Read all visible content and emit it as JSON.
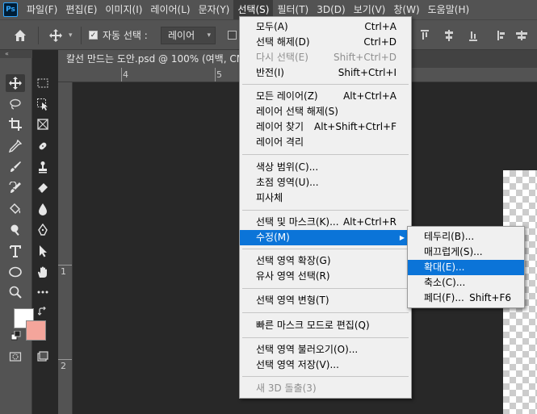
{
  "app": {
    "logo_text": "Ps"
  },
  "menubar": {
    "items": [
      {
        "label": "파일(F)"
      },
      {
        "label": "편집(E)"
      },
      {
        "label": "이미지(I)"
      },
      {
        "label": "레이어(L)"
      },
      {
        "label": "문자(Y)"
      },
      {
        "label": "선택(S)"
      },
      {
        "label": "필터(T)"
      },
      {
        "label": "3D(D)"
      },
      {
        "label": "보기(V)"
      },
      {
        "label": "창(W)"
      },
      {
        "label": "도움말(H)"
      }
    ],
    "active_index": 5
  },
  "options": {
    "auto_select_label": "자동 선택 :",
    "auto_select_checked": true,
    "target_value": "레이어"
  },
  "document": {
    "tab_title": "칼선 만드는 도안.psd @ 100% (여백, CM",
    "ruler_top_labels": [
      "4",
      "5"
    ],
    "ruler_left_labels": [
      "1",
      "2"
    ]
  },
  "colors": {
    "foreground": "#ffffff",
    "background": "#f4a59b",
    "menu_highlight": "#0b74d8"
  },
  "select_menu": {
    "items": [
      {
        "label": "모두(A)",
        "shortcut": "Ctrl+A"
      },
      {
        "label": "선택 해제(D)",
        "shortcut": "Ctrl+D"
      },
      {
        "label": "다시 선택(E)",
        "shortcut": "Shift+Ctrl+D",
        "disabled": true
      },
      {
        "label": "반전(I)",
        "shortcut": "Shift+Ctrl+I"
      },
      {
        "label": "모든 레이어(Z)",
        "shortcut": "Alt+Ctrl+A"
      },
      {
        "label": "레이어 선택 해제(S)",
        "shortcut": ""
      },
      {
        "label": "레이어 찾기",
        "shortcut": "Alt+Shift+Ctrl+F"
      },
      {
        "label": "레이어 격리",
        "shortcut": ""
      },
      {
        "label": "색상 범위(C)...",
        "shortcut": ""
      },
      {
        "label": "초점 영역(U)...",
        "shortcut": ""
      },
      {
        "label": "피사체",
        "shortcut": ""
      },
      {
        "label": "선택 및 마스크(K)...",
        "shortcut": "Alt+Ctrl+R"
      },
      {
        "label": "수정(M)",
        "shortcut": "",
        "submenu": true,
        "highlighted": true
      },
      {
        "label": "선택 영역 확장(G)",
        "shortcut": ""
      },
      {
        "label": "유사 영역 선택(R)",
        "shortcut": ""
      },
      {
        "label": "선택 영역 변형(T)",
        "shortcut": ""
      },
      {
        "label": "빠른 마스크 모드로 편집(Q)",
        "shortcut": ""
      },
      {
        "label": "선택 영역 불러오기(O)...",
        "shortcut": ""
      },
      {
        "label": "선택 영역 저장(V)...",
        "shortcut": ""
      },
      {
        "label": "새 3D 돌출(3)",
        "shortcut": "",
        "disabled": true
      }
    ]
  },
  "modify_submenu": {
    "items": [
      {
        "label": "테두리(B)...",
        "shortcut": ""
      },
      {
        "label": "매끄럽게(S)...",
        "shortcut": ""
      },
      {
        "label": "확대(E)...",
        "shortcut": "",
        "highlighted": true
      },
      {
        "label": "축소(C)...",
        "shortcut": ""
      },
      {
        "label": "페더(F)...",
        "shortcut": "Shift+F6"
      }
    ]
  }
}
